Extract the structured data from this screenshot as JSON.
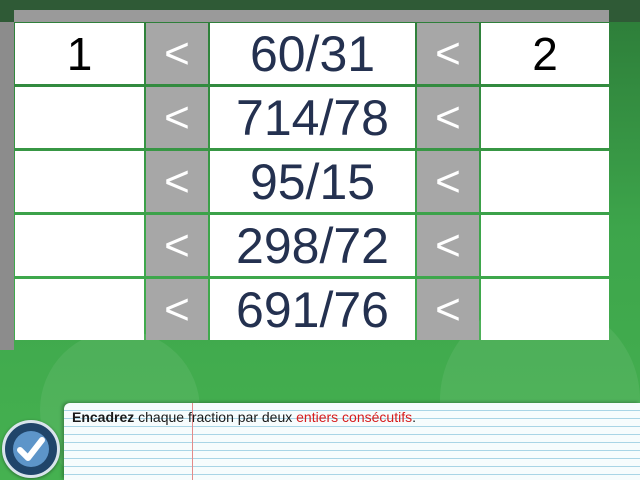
{
  "exercise": {
    "rows": [
      {
        "lower": "1",
        "left_sign": "<",
        "fraction": "60/31",
        "right_sign": "<",
        "upper": "2"
      },
      {
        "lower": "",
        "left_sign": "<",
        "fraction": "714/78",
        "right_sign": "<",
        "upper": ""
      },
      {
        "lower": "",
        "left_sign": "<",
        "fraction": "95/15",
        "right_sign": "<",
        "upper": ""
      },
      {
        "lower": "",
        "left_sign": "<",
        "fraction": "298/72",
        "right_sign": "<",
        "upper": ""
      },
      {
        "lower": "",
        "left_sign": "<",
        "fraction": "691/76",
        "right_sign": "<",
        "upper": ""
      }
    ]
  },
  "instruction": {
    "bold_part": "Encadrez",
    "middle_part": " chaque fraction par deux ",
    "highlight_part": "entiers consécutifs",
    "end_part": "."
  },
  "validate_button": {
    "icon": "checkmark-icon"
  },
  "colors": {
    "background_green": "#3aa64a",
    "fraction_text": "#243150",
    "sign_cell": "#a7a7a7",
    "highlight_red": "#d71c1c",
    "validate_button": "#20456a"
  }
}
